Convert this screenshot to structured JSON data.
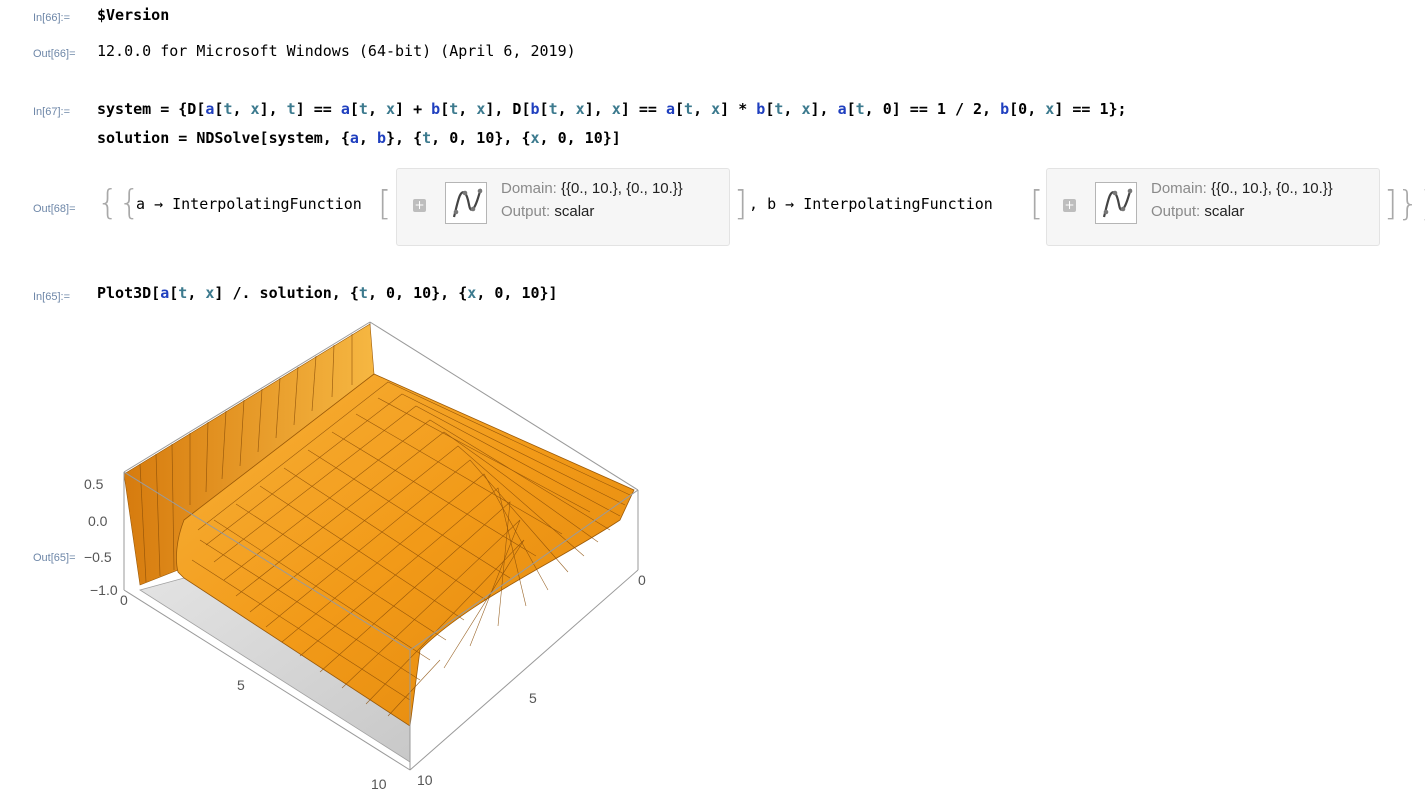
{
  "cells": {
    "in66": {
      "label": "In[66]:=",
      "code": "$Version"
    },
    "out66": {
      "label": "Out[66]=",
      "text": "12.0.0 for Microsoft Windows (64-bit) (April 6, 2019)"
    },
    "in67": {
      "label": "In[67]:="
    },
    "out68": {
      "label": "Out[68]=",
      "a_name": "a",
      "b_name": "b",
      "arrow": "→",
      "head": "InterpolatingFunction",
      "domain_key": "Domain:",
      "domain_value": "{{0., 10.}, {0., 10.}}",
      "output_key": "Output:",
      "output_value": "scalar",
      "expand_icon": "plus-icon"
    },
    "in65": {
      "label": "In[65]:="
    },
    "out65": {
      "label": "Out[65]=",
      "zticks": [
        "0.5",
        "0.0",
        "−0.5",
        "−1.0"
      ],
      "tticks": [
        "0",
        "5",
        "10"
      ],
      "xticks": [
        "0",
        "5",
        "10"
      ]
    }
  },
  "colors": {
    "surface": "#f5a623",
    "surface_dark": "#c07012",
    "wall": "#d6d6d6",
    "label": "#6e87a8",
    "symbol": "#1f3fbf",
    "local": "#3c7a8e"
  }
}
